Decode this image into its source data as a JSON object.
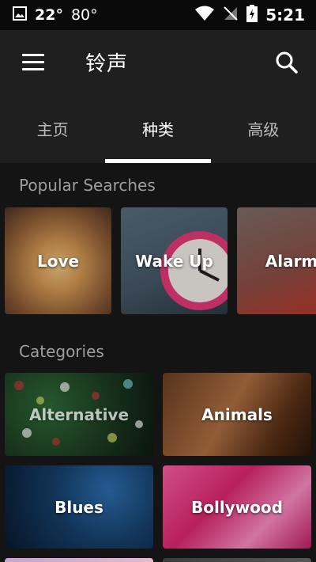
{
  "status_bar": {
    "temp1": "22°",
    "temp2": "80°",
    "time": "5:21"
  },
  "app_bar": {
    "title": "铃声"
  },
  "tabs": [
    {
      "label": "主页",
      "active": false
    },
    {
      "label": "种类",
      "active": true
    },
    {
      "label": "高级",
      "active": false
    }
  ],
  "popular": {
    "heading": "Popular Searches",
    "items": [
      {
        "label": "Love"
      },
      {
        "label": "Wake Up"
      },
      {
        "label": "Alarm"
      }
    ]
  },
  "categories": {
    "heading": "Categories",
    "items": [
      {
        "label": "Alternative"
      },
      {
        "label": "Animals"
      },
      {
        "label": "Blues"
      },
      {
        "label": "Bollywood"
      }
    ]
  }
}
